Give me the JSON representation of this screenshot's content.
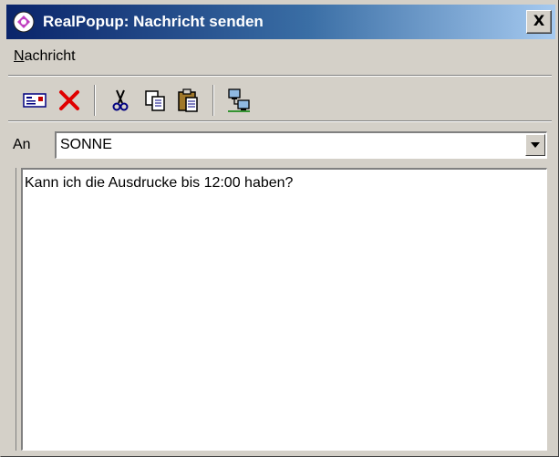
{
  "window": {
    "title": "RealPopup: Nachricht senden",
    "close_glyph": "X"
  },
  "menu": {
    "items": [
      {
        "label": "Nachricht",
        "accelerator": "N",
        "rest": "achricht"
      }
    ]
  },
  "toolbar": {
    "buttons": [
      {
        "name": "address-card-icon",
        "title": ""
      },
      {
        "name": "delete-icon",
        "title": ""
      },
      {
        "name": "cut-icon",
        "title": ""
      },
      {
        "name": "copy-icon",
        "title": ""
      },
      {
        "name": "paste-icon",
        "title": ""
      },
      {
        "name": "network-icon",
        "title": ""
      }
    ]
  },
  "recipient": {
    "label": "An",
    "value": "SONNE"
  },
  "message": {
    "text": "Kann ich die Ausdrucke bis 12:00 haben?"
  },
  "colors": {
    "title_gradient_start": "#0a246a",
    "title_gradient_end": "#a6caf0",
    "face": "#d4d0c8",
    "delete_red": "#e00000"
  }
}
